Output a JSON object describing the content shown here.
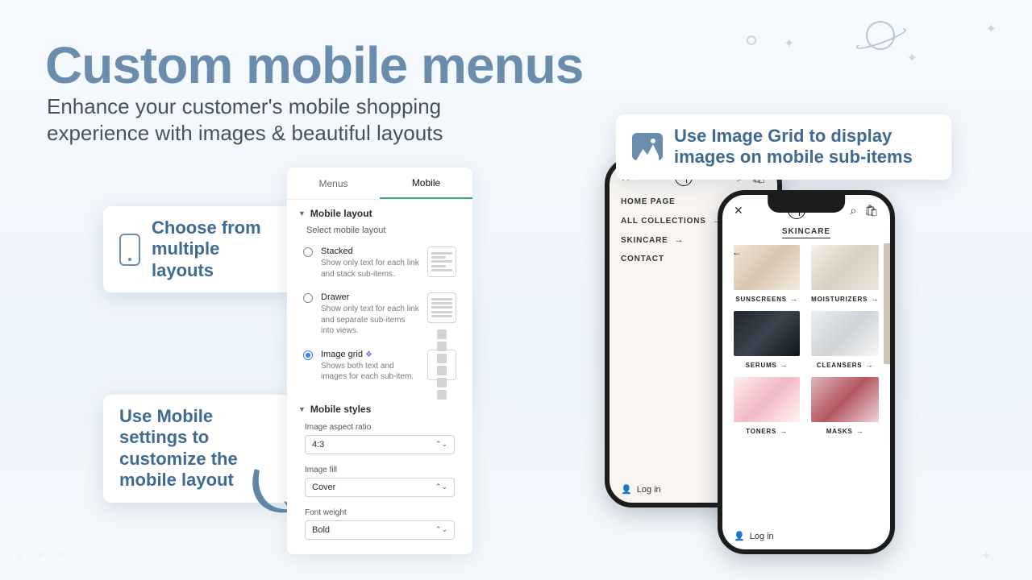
{
  "hero": {
    "title": "Custom mobile menus",
    "subtitle": "Enhance your customer's mobile shopping experience with images & beautiful layouts"
  },
  "callouts": {
    "layouts": "Choose from multiple layouts",
    "settings": "Use Mobile settings to customize the mobile layout",
    "imagegrid": "Use Image Grid to display images on mobile sub-items"
  },
  "settings": {
    "tabs": {
      "menus": "Menus",
      "mobile": "Mobile"
    },
    "layout_section": "Mobile layout",
    "select_label": "Select mobile layout",
    "options": {
      "stacked": {
        "title": "Stacked",
        "desc": "Show only text for each link and stack sub-items."
      },
      "drawer": {
        "title": "Drawer",
        "desc": "Show only text for each link and separate sub-items into views."
      },
      "grid": {
        "title": "Image grid",
        "desc": "Shows both text and images for each sub-item."
      }
    },
    "styles_section": "Mobile styles",
    "aspect": {
      "label": "Image aspect ratio",
      "value": "4:3"
    },
    "fill": {
      "label": "Image fill",
      "value": "Cover"
    },
    "weight": {
      "label": "Font weight",
      "value": "Bold"
    }
  },
  "phone_back": {
    "close_glyph": "✕",
    "nav": [
      "HOME PAGE",
      "ALL COLLECTIONS",
      "SKINCARE",
      "CONTACT"
    ],
    "login": "Log in"
  },
  "phone_front": {
    "close_glyph": "✕",
    "category": "SKINCARE",
    "tiles": [
      "SUNSCREENS",
      "MOISTURIZERS",
      "SERUMS",
      "CLEANSERS",
      "TONERS",
      "MASKS"
    ],
    "login": "Log in"
  }
}
